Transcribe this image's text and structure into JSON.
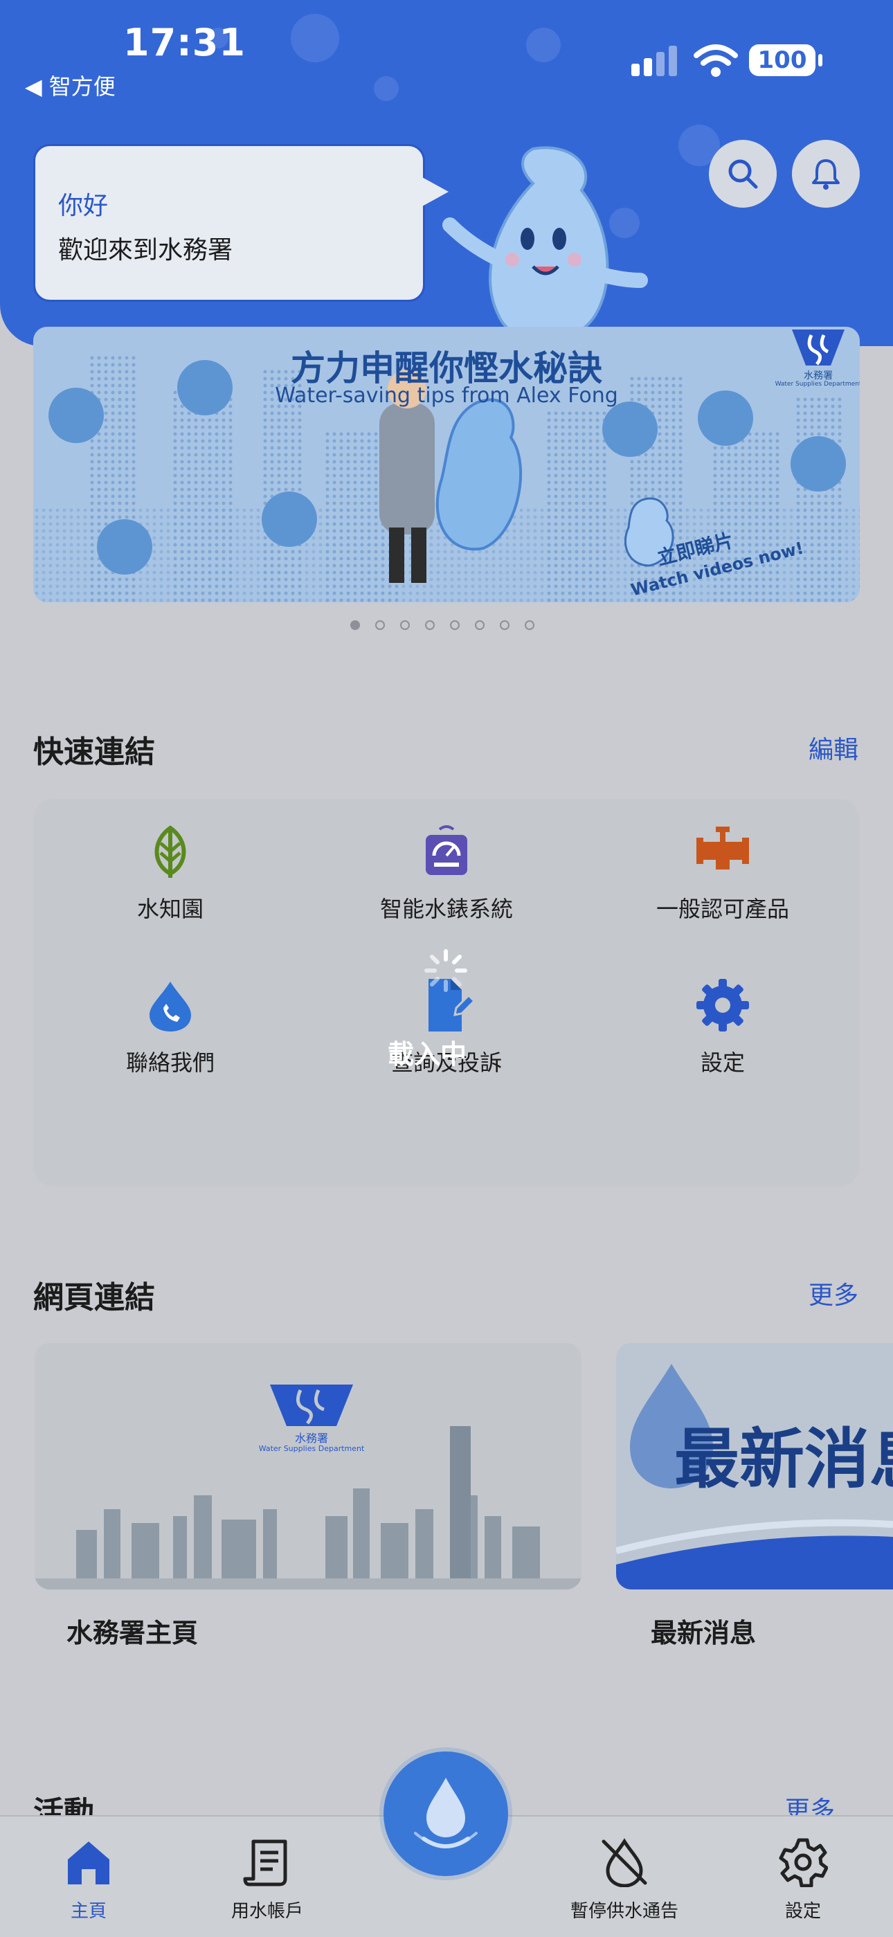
{
  "status_bar": {
    "time": "17:31",
    "back_label": "◀ 智方便",
    "battery": "100"
  },
  "greeting": {
    "title": "你好",
    "subtitle": "歡迎來到水務署"
  },
  "banner": {
    "title": "方力申醒你慳水秘訣",
    "subtitle": "Water-saving tips from Alex Fong",
    "cta_zh": "立即睇片",
    "cta_en": "Watch videos now!",
    "logo_text": "水務署",
    "logo_sub": "Water Supplies Department",
    "page_count": 8,
    "active_page": 1
  },
  "quick_links": {
    "title": "快速連結",
    "edit_label": "編輯",
    "items": [
      {
        "label": "水知園",
        "icon": "leaf-icon",
        "color": "#5a8a1e"
      },
      {
        "label": "智能水錶系統",
        "icon": "water-meter-icon",
        "color": "#5b4fb3"
      },
      {
        "label": "一般認可產品",
        "icon": "faucet-icon",
        "color": "#c8561c"
      },
      {
        "label": "聯絡我們",
        "icon": "phone-drop-icon",
        "color": "#2f73d6"
      },
      {
        "label": "查詢及投訴",
        "icon": "document-edit-icon",
        "color": "#2f73d6"
      },
      {
        "label": "設定",
        "icon": "gear-icon",
        "color": "#2a57c7"
      }
    ],
    "loading_text": "載入中"
  },
  "web_links": {
    "title": "網頁連結",
    "more_label": "更多",
    "items": [
      {
        "label": "水務署主頁",
        "card_logo": "水務署",
        "card_logo_sub": "Water Supplies Department"
      },
      {
        "label": "最新消息",
        "card_text": "最新消息"
      }
    ]
  },
  "activities": {
    "title": "活動",
    "more_label": "更多"
  },
  "tab_bar": {
    "items": [
      {
        "label": "主頁",
        "icon": "home-icon",
        "active": true
      },
      {
        "label": "用水帳戶",
        "icon": "account-document-icon",
        "active": false
      },
      {
        "label": "暫停供水通告",
        "icon": "water-off-icon",
        "active": false
      },
      {
        "label": "設定",
        "icon": "gear-icon",
        "active": false
      }
    ],
    "center_icon": "water-drop-icon"
  },
  "colors": {
    "brand_blue": "#3467d6",
    "link_blue": "#2a57c7"
  }
}
